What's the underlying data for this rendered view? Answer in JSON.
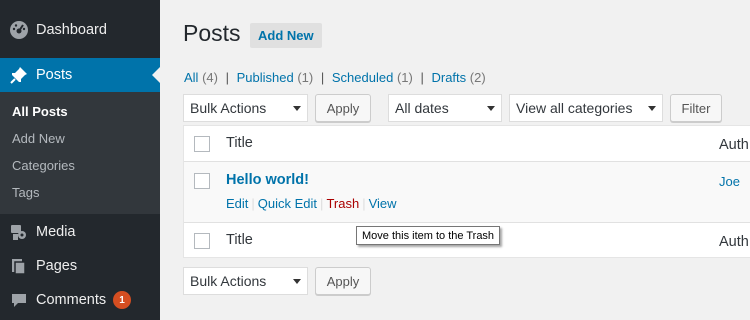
{
  "sidebar": {
    "dashboard": "Dashboard",
    "posts": "Posts",
    "submenu": [
      "All Posts",
      "Add New",
      "Categories",
      "Tags"
    ],
    "media": "Media",
    "pages": "Pages",
    "comments": "Comments",
    "comments_badge": "1"
  },
  "header": {
    "title": "Posts",
    "add_new": "Add New"
  },
  "filters": {
    "all": "All",
    "all_count": "(4)",
    "published": "Published",
    "published_count": "(1)",
    "scheduled": "Scheduled",
    "scheduled_count": "(1)",
    "drafts": "Drafts",
    "drafts_count": "(2)",
    "separator": "|"
  },
  "toolbar": {
    "bulk_actions": "Bulk Actions",
    "apply": "Apply",
    "dates": "All dates",
    "categories": "View all categories",
    "filter": "Filter"
  },
  "table": {
    "col_title": "Title",
    "col_author": "Auth",
    "post": {
      "title": "Hello world!",
      "author": "Joe",
      "actions": [
        "Edit",
        "Quick Edit",
        "Trash",
        "View"
      ]
    }
  },
  "tooltip": "Move this item to the Trash",
  "colors": {
    "sidebar_bg": "#23282d",
    "active_menu": "#0073aa",
    "link": "#0073aa",
    "trash": "#a00",
    "badge": "#d54e21"
  },
  "icons": [
    "dashboard-icon",
    "pin-icon",
    "media-icon",
    "pages-icon",
    "comments-icon"
  ]
}
